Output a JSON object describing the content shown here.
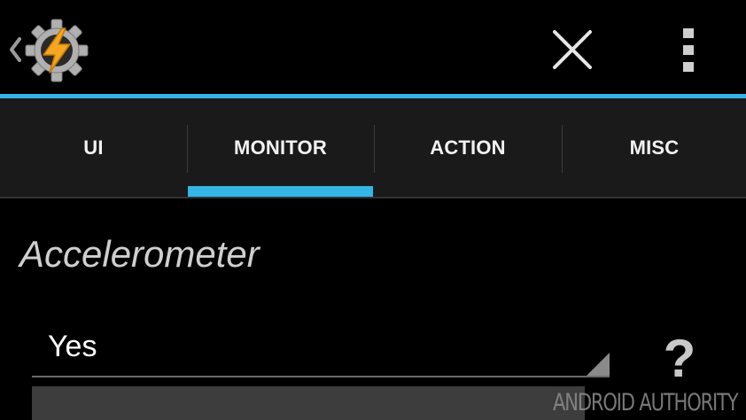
{
  "app_bar": {
    "back_icon": "chevron-left-icon",
    "logo_icon": "tasker-gear-lightning-logo",
    "close_icon": "close-x-icon",
    "overflow_icon": "vertical-dots-menu-icon"
  },
  "tabs": [
    {
      "label": "UI",
      "selected": false
    },
    {
      "label": "MONITOR",
      "selected": true
    },
    {
      "label": "ACTION",
      "selected": false
    },
    {
      "label": "MISC",
      "selected": false
    }
  ],
  "content": {
    "section_title": "Accelerometer",
    "spinner_value": "Yes",
    "help_label": "?"
  },
  "watermark": "ANDROID AUTHORITY",
  "colors": {
    "accent": "#33b5e5",
    "background": "#000000",
    "tab_bar": "#1a1a1a",
    "logo_gear": "#b0b0b0",
    "logo_bolt": "#f5a623"
  }
}
